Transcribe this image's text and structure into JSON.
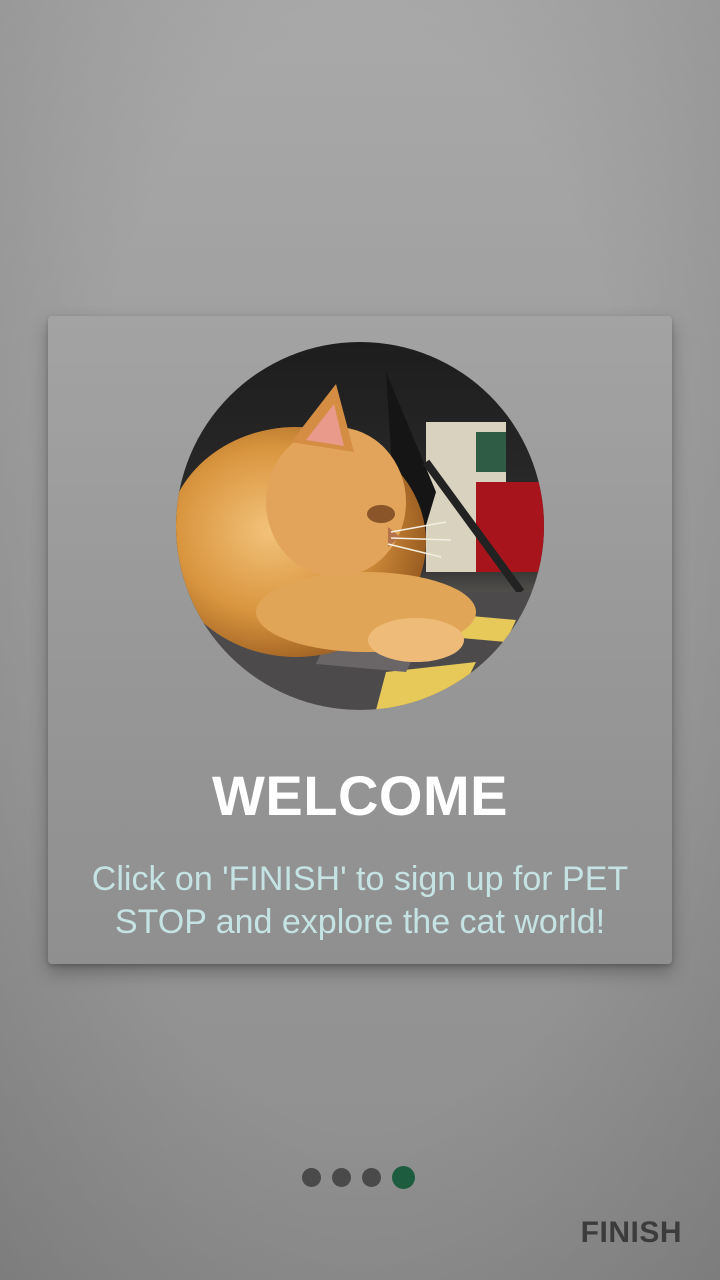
{
  "onboarding": {
    "image_alt": "Orange cat lying on a rug",
    "title": "WELCOME",
    "description": "Click on 'FINISH' to sign up for PET STOP and explore the cat world!",
    "page_indicator": {
      "total_pages": 4,
      "current_page": 4,
      "active_color": "#1e5c40",
      "inactive_color": "#4a4a4a"
    },
    "finish_label": "FINISH"
  },
  "colors": {
    "title_text": "#ffffff",
    "description_text": "#c5e3e3",
    "finish_text": "#3c3c3c"
  }
}
